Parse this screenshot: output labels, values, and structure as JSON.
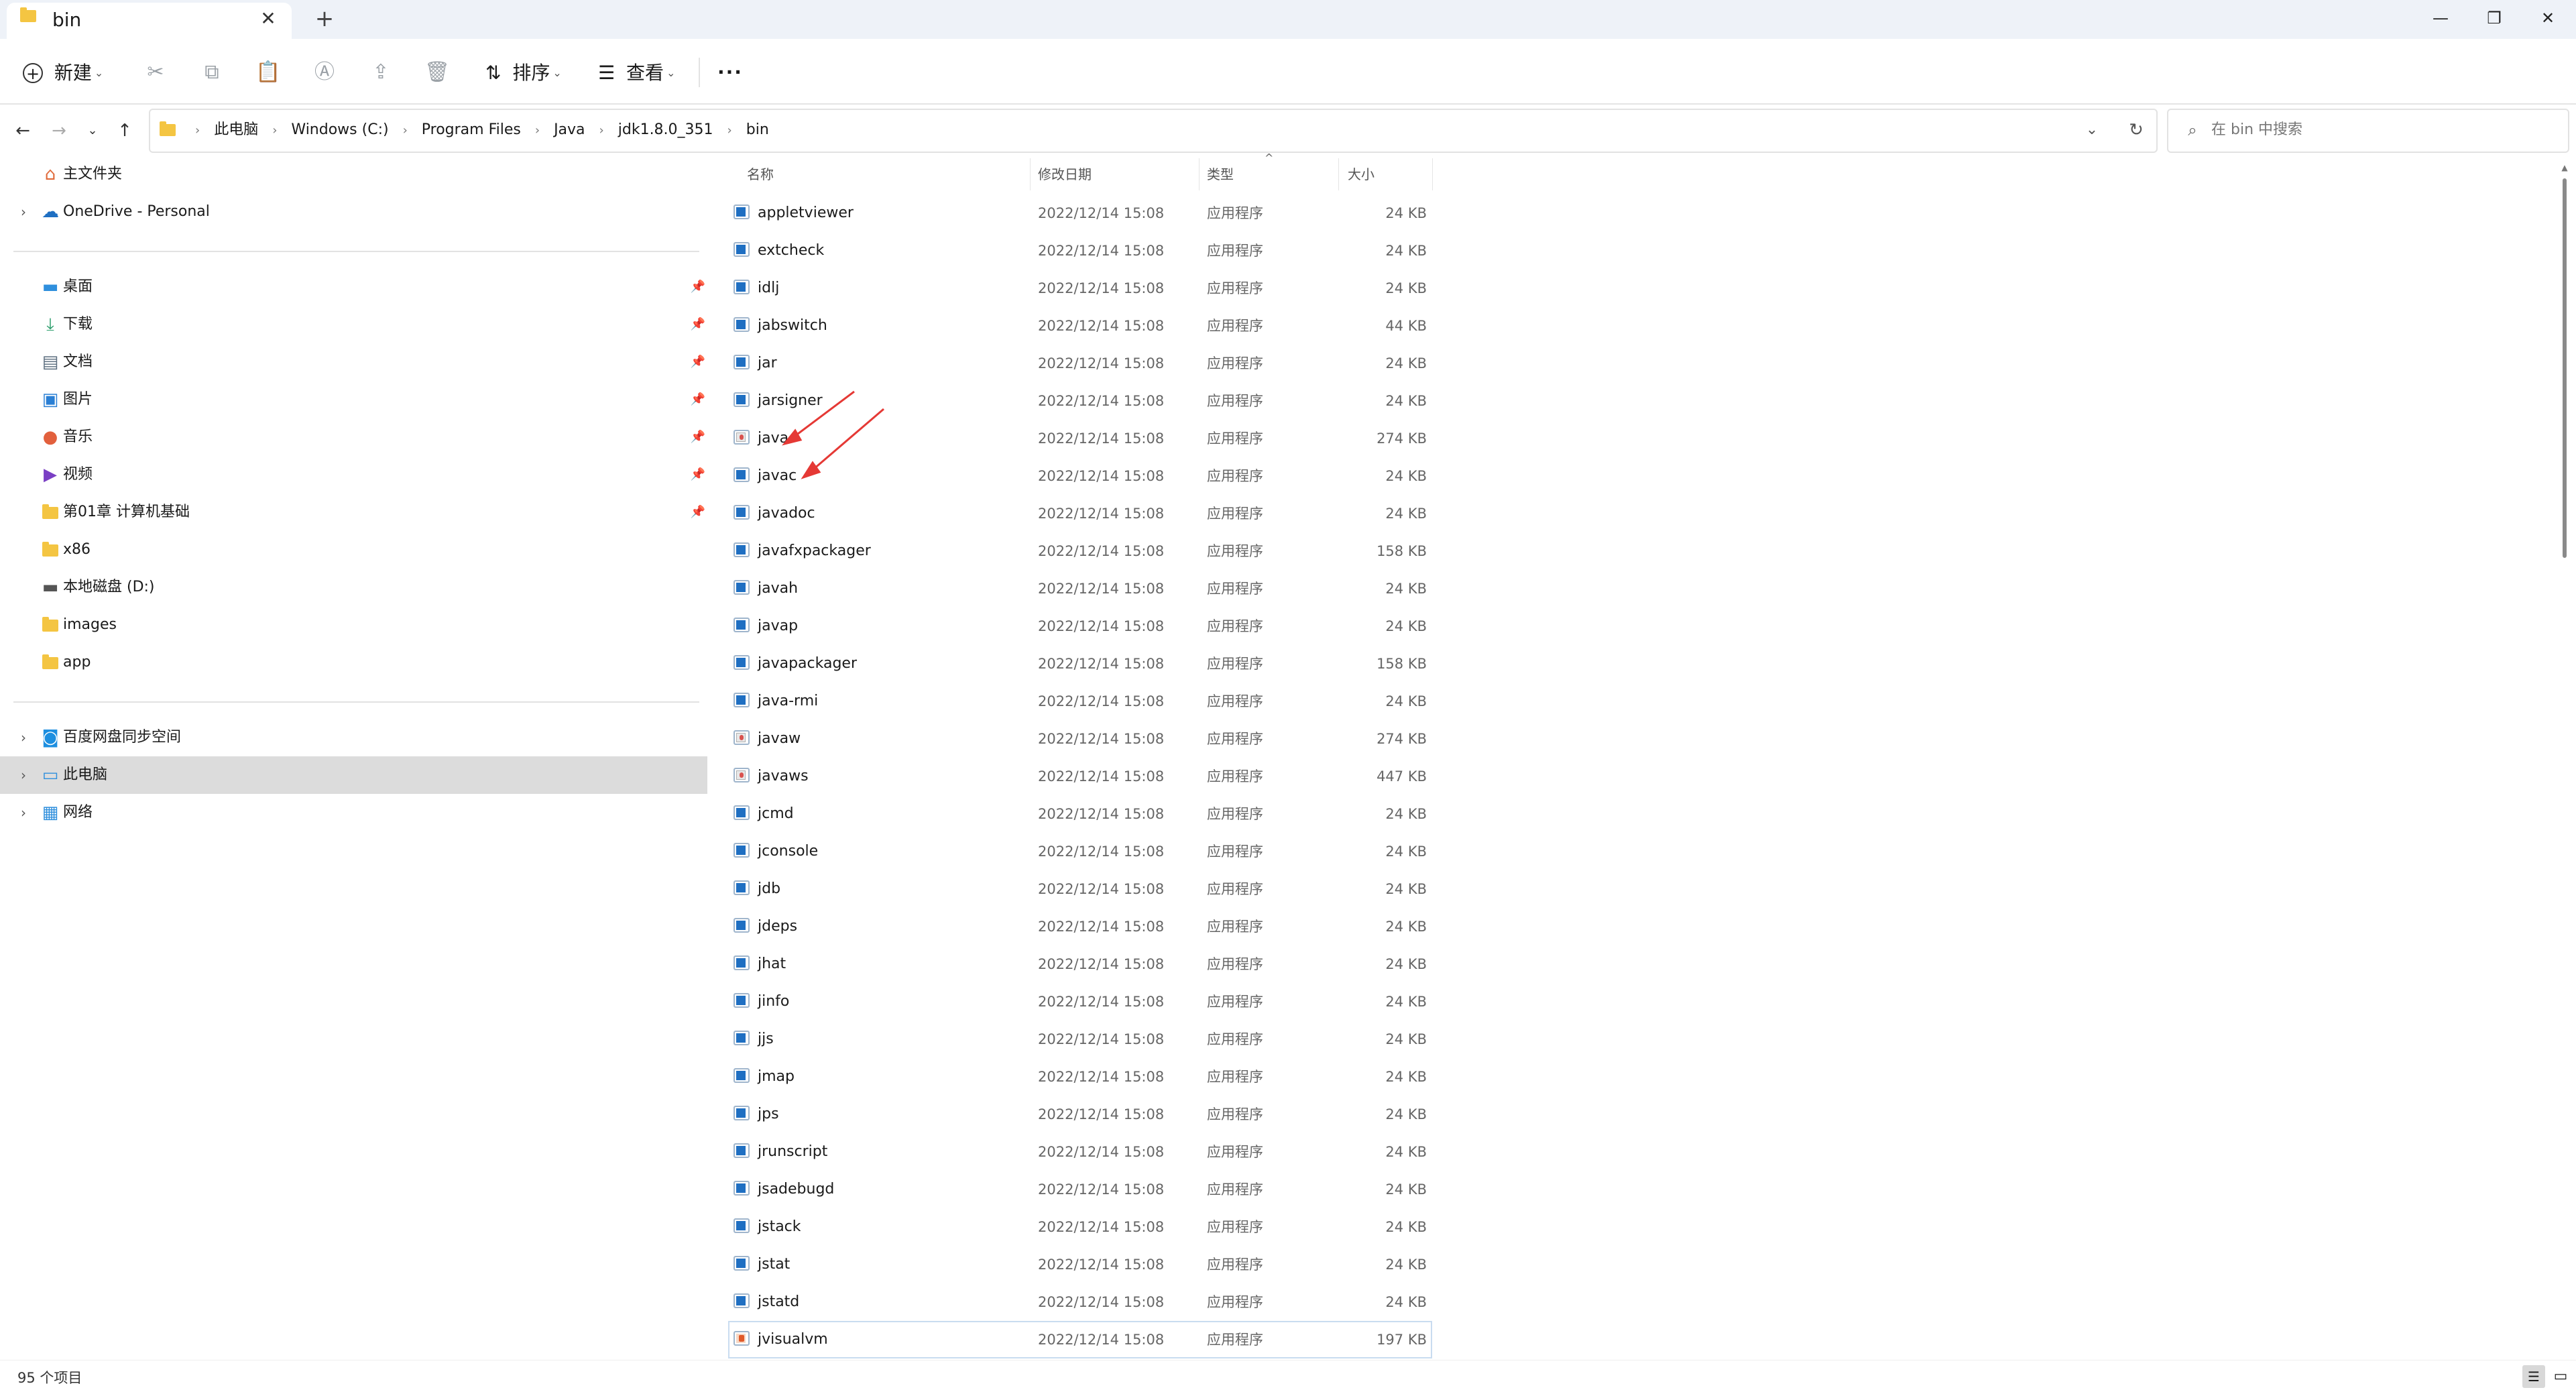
{
  "window": {
    "tab_title": "bin",
    "tab_close": "✕",
    "new_tab": "+",
    "minimize": "—",
    "restore": "❐",
    "close": "✕"
  },
  "toolbar": {
    "new_label": "新建",
    "sort_label": "排序",
    "view_label": "查看",
    "more": "···"
  },
  "address": {
    "crumbs": [
      "此电脑",
      "Windows (C:)",
      "Program Files",
      "Java",
      "jdk1.8.0_351",
      "bin"
    ],
    "search_placeholder": "在 bin 中搜索"
  },
  "sidebar": {
    "top": [
      {
        "label": "主文件夹",
        "icon": "home-icon"
      },
      {
        "label": "OneDrive - Personal",
        "icon": "cloud-icon",
        "expandable": true
      }
    ],
    "quick": [
      {
        "label": "桌面",
        "icon": "desktop-icon",
        "pinned": true
      },
      {
        "label": "下载",
        "icon": "download-icon",
        "pinned": true
      },
      {
        "label": "文档",
        "icon": "document-icon",
        "pinned": true
      },
      {
        "label": "图片",
        "icon": "picture-icon",
        "pinned": true
      },
      {
        "label": "音乐",
        "icon": "music-icon",
        "pinned": true
      },
      {
        "label": "视频",
        "icon": "video-icon",
        "pinned": true
      },
      {
        "label": "第01章 计算机基础",
        "icon": "folder-icon",
        "pinned": true
      },
      {
        "label": "x86",
        "icon": "folder-icon",
        "pinned": false
      },
      {
        "label": "本地磁盘 (D:)",
        "icon": "drive-icon",
        "pinned": false
      },
      {
        "label": "images",
        "icon": "folder-icon",
        "pinned": false
      },
      {
        "label": "app",
        "icon": "folder-icon",
        "pinned": false
      }
    ],
    "bottom": [
      {
        "label": "百度网盘同步空间",
        "icon": "baidu-icon"
      },
      {
        "label": "此电脑",
        "icon": "computer-icon",
        "selected": true
      },
      {
        "label": "网络",
        "icon": "network-icon"
      }
    ]
  },
  "columns": {
    "name": "名称",
    "date": "修改日期",
    "type": "类型",
    "size": "大小"
  },
  "files": [
    {
      "name": "appletviewer",
      "date": "2022/12/14 15:08",
      "type": "应用程序",
      "size": "24 KB",
      "icon": "exe"
    },
    {
      "name": "extcheck",
      "date": "2022/12/14 15:08",
      "type": "应用程序",
      "size": "24 KB",
      "icon": "exe"
    },
    {
      "name": "idlj",
      "date": "2022/12/14 15:08",
      "type": "应用程序",
      "size": "24 KB",
      "icon": "exe"
    },
    {
      "name": "jabswitch",
      "date": "2022/12/14 15:08",
      "type": "应用程序",
      "size": "44 KB",
      "icon": "exe"
    },
    {
      "name": "jar",
      "date": "2022/12/14 15:08",
      "type": "应用程序",
      "size": "24 KB",
      "icon": "exe"
    },
    {
      "name": "jarsigner",
      "date": "2022/12/14 15:08",
      "type": "应用程序",
      "size": "24 KB",
      "icon": "exe"
    },
    {
      "name": "java",
      "date": "2022/12/14 15:08",
      "type": "应用程序",
      "size": "274 KB",
      "icon": "java"
    },
    {
      "name": "javac",
      "date": "2022/12/14 15:08",
      "type": "应用程序",
      "size": "24 KB",
      "icon": "exe"
    },
    {
      "name": "javadoc",
      "date": "2022/12/14 15:08",
      "type": "应用程序",
      "size": "24 KB",
      "icon": "exe"
    },
    {
      "name": "javafxpackager",
      "date": "2022/12/14 15:08",
      "type": "应用程序",
      "size": "158 KB",
      "icon": "exe"
    },
    {
      "name": "javah",
      "date": "2022/12/14 15:08",
      "type": "应用程序",
      "size": "24 KB",
      "icon": "exe"
    },
    {
      "name": "javap",
      "date": "2022/12/14 15:08",
      "type": "应用程序",
      "size": "24 KB",
      "icon": "exe"
    },
    {
      "name": "javapackager",
      "date": "2022/12/14 15:08",
      "type": "应用程序",
      "size": "158 KB",
      "icon": "exe"
    },
    {
      "name": "java-rmi",
      "date": "2022/12/14 15:08",
      "type": "应用程序",
      "size": "24 KB",
      "icon": "exe"
    },
    {
      "name": "javaw",
      "date": "2022/12/14 15:08",
      "type": "应用程序",
      "size": "274 KB",
      "icon": "java"
    },
    {
      "name": "javaws",
      "date": "2022/12/14 15:08",
      "type": "应用程序",
      "size": "447 KB",
      "icon": "java"
    },
    {
      "name": "jcmd",
      "date": "2022/12/14 15:08",
      "type": "应用程序",
      "size": "24 KB",
      "icon": "exe"
    },
    {
      "name": "jconsole",
      "date": "2022/12/14 15:08",
      "type": "应用程序",
      "size": "24 KB",
      "icon": "exe"
    },
    {
      "name": "jdb",
      "date": "2022/12/14 15:08",
      "type": "应用程序",
      "size": "24 KB",
      "icon": "exe"
    },
    {
      "name": "jdeps",
      "date": "2022/12/14 15:08",
      "type": "应用程序",
      "size": "24 KB",
      "icon": "exe"
    },
    {
      "name": "jhat",
      "date": "2022/12/14 15:08",
      "type": "应用程序",
      "size": "24 KB",
      "icon": "exe"
    },
    {
      "name": "jinfo",
      "date": "2022/12/14 15:08",
      "type": "应用程序",
      "size": "24 KB",
      "icon": "exe"
    },
    {
      "name": "jjs",
      "date": "2022/12/14 15:08",
      "type": "应用程序",
      "size": "24 KB",
      "icon": "exe"
    },
    {
      "name": "jmap",
      "date": "2022/12/14 15:08",
      "type": "应用程序",
      "size": "24 KB",
      "icon": "exe"
    },
    {
      "name": "jps",
      "date": "2022/12/14 15:08",
      "type": "应用程序",
      "size": "24 KB",
      "icon": "exe"
    },
    {
      "name": "jrunscript",
      "date": "2022/12/14 15:08",
      "type": "应用程序",
      "size": "24 KB",
      "icon": "exe"
    },
    {
      "name": "jsadebugd",
      "date": "2022/12/14 15:08",
      "type": "应用程序",
      "size": "24 KB",
      "icon": "exe"
    },
    {
      "name": "jstack",
      "date": "2022/12/14 15:08",
      "type": "应用程序",
      "size": "24 KB",
      "icon": "exe"
    },
    {
      "name": "jstat",
      "date": "2022/12/14 15:08",
      "type": "应用程序",
      "size": "24 KB",
      "icon": "exe"
    },
    {
      "name": "jstatd",
      "date": "2022/12/14 15:08",
      "type": "应用程序",
      "size": "24 KB",
      "icon": "exe"
    },
    {
      "name": "jvisualvm",
      "date": "2022/12/14 15:08",
      "type": "应用程序",
      "size": "197 KB",
      "icon": "visual",
      "focused": true
    }
  ],
  "status": {
    "item_count": "95 个项目"
  },
  "colors": {
    "accent": "#1f6fc2",
    "annotation_arrow": "#e53935",
    "selection": "#dcdcdc",
    "titlebar": "#eef2f8"
  }
}
